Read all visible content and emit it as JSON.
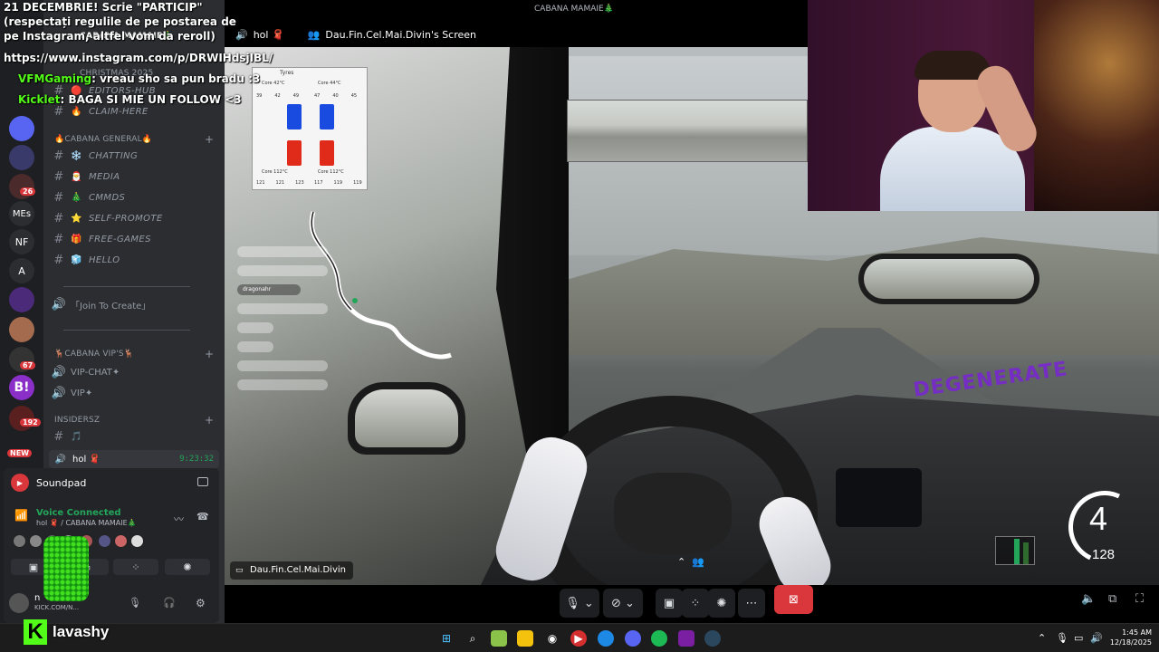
{
  "chat": {
    "lines": [
      {
        "text": "21 DECEMBRIE! Scrie \"PARTICIP\" (respectați regulile de pe postarea de pe Instagram, altfel vom da reroll)"
      },
      {
        "text": "https://www.instagram.com/p/DRWIHdsjIBL/"
      }
    ],
    "messages": [
      {
        "user": "VFMGaming",
        "text": ": vreau sho sa pun bradu :3"
      },
      {
        "user": "Kicklet",
        "text": ": BAGA SI MIE UN FOLLOW <3"
      }
    ]
  },
  "server_rail": {
    "items": [
      "",
      "",
      "",
      "",
      "26",
      "MEs",
      "NF",
      "A",
      "",
      "",
      "67",
      "B!",
      "192",
      ""
    ],
    "labels": {
      "mes": "MEs",
      "nf": "NF",
      "a": "A",
      "badge_26": "26",
      "badge_67": "67",
      "badge_192": "192",
      "new": "NEW"
    }
  },
  "sidebar": {
    "server_name": "CABANA MAMAIE🎄",
    "top_channels": [
      "EDITORS-HUB",
      "CLAIM-HERE"
    ],
    "christmas_label": "CHRISTMAS 2025",
    "category_general": "🔥CABANA GENERAL🔥",
    "channels": [
      {
        "emoji": "❄️",
        "name": "CHATTING"
      },
      {
        "emoji": "🎅",
        "name": "MEDIA"
      },
      {
        "emoji": "🎄",
        "name": "CMMDS"
      },
      {
        "emoji": "⭐",
        "name": "SELF-PROMOTE"
      },
      {
        "emoji": "🎁",
        "name": "FREE-GAMES"
      },
      {
        "emoji": "🧊",
        "name": "HELLO"
      }
    ],
    "join_to_create": "「Join To Create」",
    "category_vip": "🦌CABANA VIP's🦌",
    "vip_channels": [
      "VIP-CHAT✦",
      "VIP✦"
    ],
    "category_insiders": "INSIDERSz",
    "insiders_channel": "",
    "voice_active": "hol 🧣",
    "voice_time": "9:23:32"
  },
  "panel": {
    "soundpad": "Soundpad",
    "voice_connected": "Voice Connected",
    "voice_sub": "hol 🧣 / CABANA MAMAIE🎄",
    "user_name": "n",
    "user_sub": "KICK.COM/N..."
  },
  "stream": {
    "window_title": "CABANA MAMAIE🎄",
    "channel": "hol 🧣",
    "screen_title": "Dau.Fin.Cel.Mai.Divin's Screen",
    "streamer_label": "Dau.Fin.Cel.Mai.Divin",
    "overlay_text": "DEGENERATE",
    "tyres": {
      "title": "Tyres",
      "fl": "Core 42°C",
      "fr": "Core 44°C",
      "rl": "Core 112°C",
      "rr": "Core 112°C",
      "fl_vals": [
        "39",
        "42",
        "49"
      ],
      "fr_vals": [
        "47",
        "40",
        "45"
      ],
      "rl_vals": [
        "121",
        "121",
        "123"
      ],
      "rr_vals": [
        "117",
        "119",
        "119"
      ]
    },
    "gear": "4",
    "speed": "128",
    "minimap_player": "dragonahr"
  },
  "kick": {
    "channel": "lavashy"
  },
  "taskbar": {
    "time": "1:45 AM",
    "date": "12/18/2025"
  },
  "colors": {
    "kick_green": "#53fc18",
    "discord_red": "#da373c",
    "voice_green": "#23a55a"
  }
}
